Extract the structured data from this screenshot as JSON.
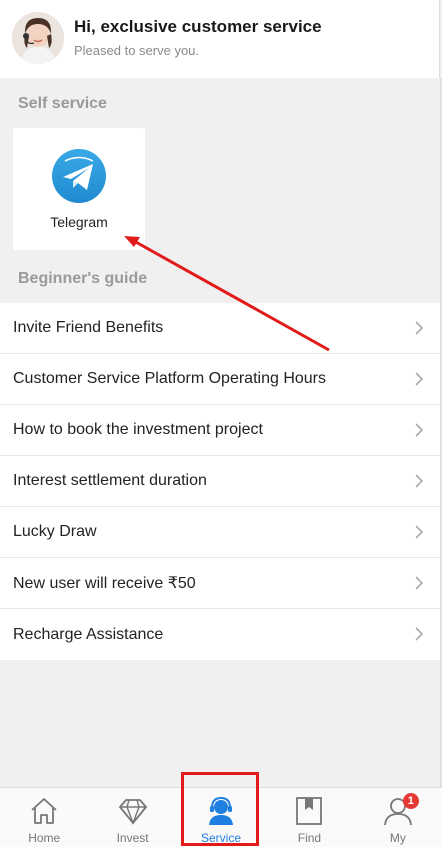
{
  "header": {
    "title": "Hi, exclusive customer service",
    "subtitle": "Pleased to serve you."
  },
  "self_service": {
    "title": "Self service",
    "tiles": [
      {
        "label": "Telegram",
        "icon": "telegram-icon"
      }
    ]
  },
  "guide": {
    "title": "Beginner's guide",
    "items": [
      {
        "label": "Invite Friend Benefits"
      },
      {
        "label": "Customer Service Platform Operating Hours"
      },
      {
        "label": "How to book the investment project"
      },
      {
        "label": "Interest settlement duration"
      },
      {
        "label": "Lucky Draw"
      },
      {
        "label": "New user will receive ₹50"
      },
      {
        "label": "Recharge Assistance"
      }
    ]
  },
  "tabbar": {
    "tabs": [
      {
        "label": "Home",
        "icon": "home-icon"
      },
      {
        "label": "Invest",
        "icon": "diamond-icon"
      },
      {
        "label": "Service",
        "icon": "customer-service-icon",
        "active": true
      },
      {
        "label": "Find",
        "icon": "bookmark-icon"
      },
      {
        "label": "My",
        "icon": "user-icon",
        "badge": "1"
      }
    ]
  },
  "colors": {
    "accent": "#1e7fe0",
    "annotation": "#e21a1a",
    "badge": "#e53935"
  }
}
